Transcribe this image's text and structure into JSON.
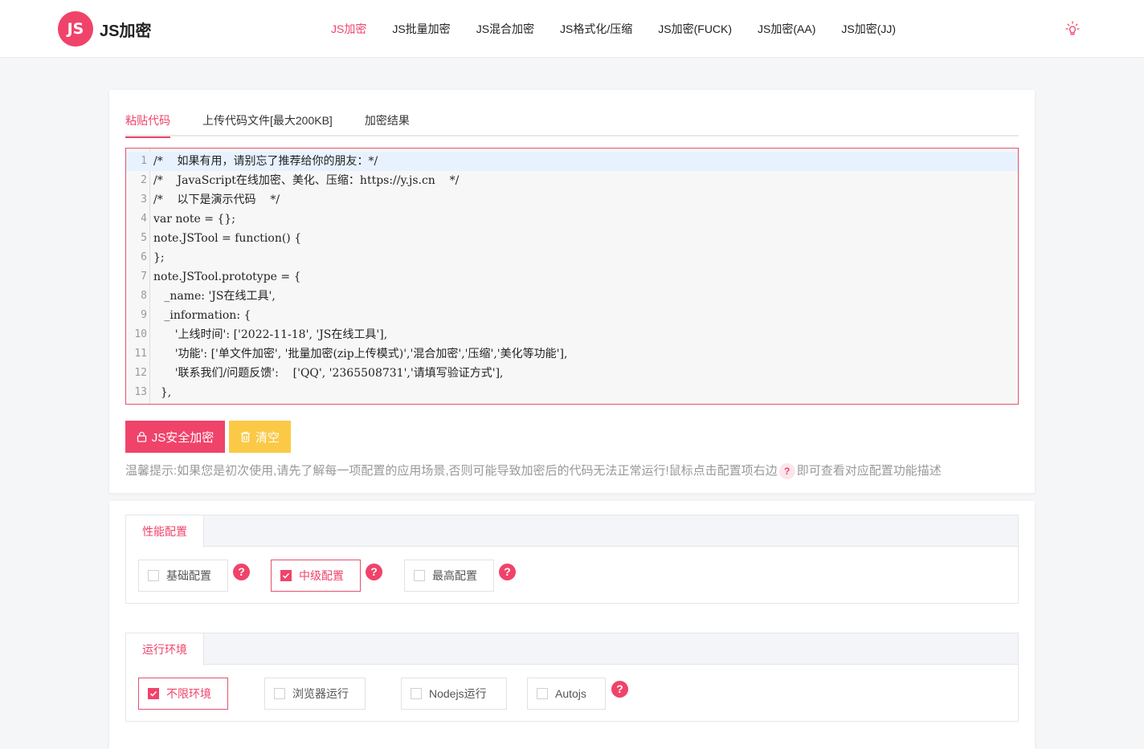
{
  "header": {
    "logo_mark": "JS",
    "logo_text": "JS加密",
    "nav": [
      {
        "label": "JS加密",
        "active": true
      },
      {
        "label": "JS批量加密",
        "active": false
      },
      {
        "label": "JS混合加密",
        "active": false
      },
      {
        "label": "JS格式化/压缩",
        "active": false
      },
      {
        "label": "JS加密(FUCK)",
        "active": false
      },
      {
        "label": "JS加密(AA)",
        "active": false
      },
      {
        "label": "JS加密(JJ)",
        "active": false
      }
    ],
    "theme_icon": "lightbulb-icon"
  },
  "tabs": [
    {
      "label": "粘贴代码",
      "active": true
    },
    {
      "label": "上传代码文件[最大200KB]",
      "active": false
    },
    {
      "label": "加密结果",
      "active": false
    }
  ],
  "editor": {
    "lines": [
      "/*    如果有用，请别忘了推荐给你的朋友：*/",
      "/*    JavaScript在线加密、美化、压缩：https://y.js.cn    */",
      "/*    以下是演示代码    */",
      "var note = {};",
      "note.JSTool = function() {",
      "};",
      "note.JSTool.prototype = {",
      "   _name: 'JS在线工具',",
      "   _information: {",
      "      '上线时间': ['2022-11-18', 'JS在线工具'],",
      "      '功能': ['单文件加密', '批量加密(zip上传模式)','混合加密','压缩','美化等功能'],",
      "      '联系我们/问题反馈':    ['QQ', '2365508731','请填写验证方式'],",
      "  },"
    ]
  },
  "actions": {
    "encrypt_label": "JS安全加密",
    "clear_label": "清空"
  },
  "tip": {
    "before": "温馨提示:如果您是初次使用,请先了解每一项配置的应用场景,否则可能导致加密后的代码无法正常运行!鼠标点击配置项右边",
    "mark": "?",
    "after": "即可查看对应配置功能描述"
  },
  "performance": {
    "title": "性能配置",
    "options": [
      {
        "label": "基础配置",
        "checked": false
      },
      {
        "label": "中级配置",
        "checked": true
      },
      {
        "label": "最高配置",
        "checked": false
      }
    ]
  },
  "environment": {
    "title": "运行环境",
    "options": [
      {
        "label": "不限环境",
        "checked": true
      },
      {
        "label": "浏览器运行",
        "checked": false
      },
      {
        "label": "Nodejs运行",
        "checked": false
      },
      {
        "label": "Autojs",
        "checked": false
      }
    ]
  },
  "help_mark": "?",
  "colors": {
    "accent": "#f0436a",
    "warn": "#fbc945"
  }
}
